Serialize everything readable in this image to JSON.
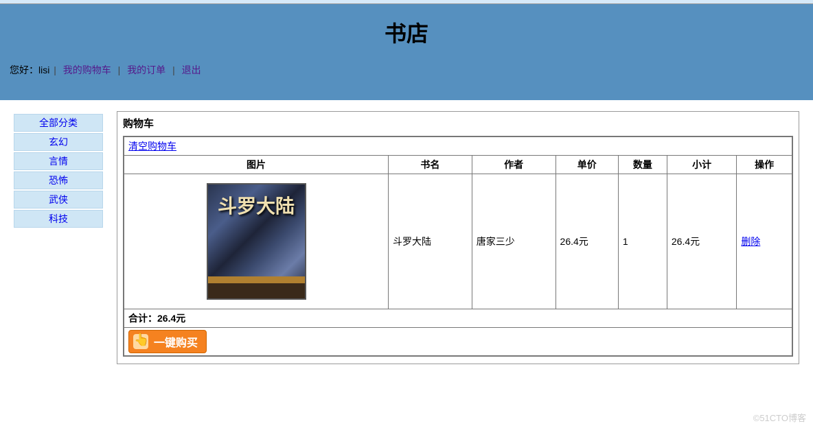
{
  "header": {
    "title": "书店",
    "greeting_prefix": "您好：",
    "username": "lisi",
    "nav": {
      "cart": "我的购物车",
      "orders": "我的订单",
      "logout": "退出"
    }
  },
  "sidebar": {
    "items": [
      {
        "label": "全部分类"
      },
      {
        "label": "玄幻"
      },
      {
        "label": "言情"
      },
      {
        "label": "恐怖"
      },
      {
        "label": "武侠"
      },
      {
        "label": "科技"
      }
    ]
  },
  "cart": {
    "title": "购物车",
    "clear_label": "清空购物车",
    "columns": {
      "image": "图片",
      "name": "书名",
      "author": "作者",
      "price": "单价",
      "qty": "数量",
      "subtotal": "小计",
      "action": "操作"
    },
    "rows": [
      {
        "img_title": "斗罗大陆",
        "name": "斗罗大陆",
        "author": "唐家三少",
        "price": "26.4元",
        "qty": "1",
        "subtotal": "26.4元",
        "delete_label": "删除"
      }
    ],
    "total_label": "合计：",
    "total_value": "26.4元",
    "buy_label": "一键购买"
  },
  "watermark": "©51CTO博客"
}
